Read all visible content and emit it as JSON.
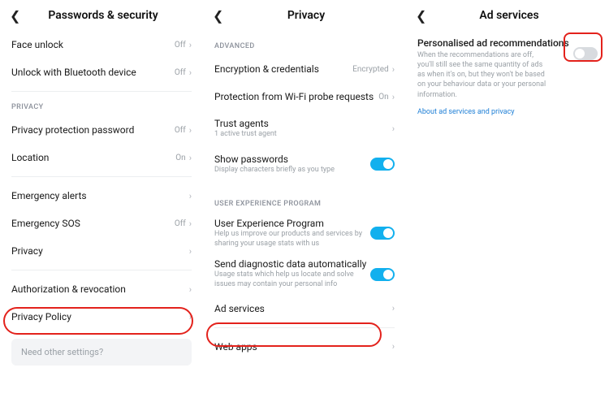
{
  "pane1": {
    "title": "Passwords & security",
    "items": {
      "face_unlock": {
        "label": "Face unlock",
        "value": "Off"
      },
      "bt_unlock": {
        "label": "Unlock with Bluetooth device",
        "value": "Off"
      },
      "section_privacy": "PRIVACY",
      "privacy_pwd": {
        "label": "Privacy protection password",
        "value": "Off"
      },
      "location": {
        "label": "Location",
        "value": "On"
      },
      "emerg_alerts": {
        "label": "Emergency alerts"
      },
      "emerg_sos": {
        "label": "Emergency SOS",
        "value": "Off"
      },
      "privacy": {
        "label": "Privacy"
      },
      "auth_rev": {
        "label": "Authorization & revocation"
      },
      "privacy_pol": {
        "label": "Privacy Policy"
      },
      "footer": "Need other settings?"
    }
  },
  "pane2": {
    "title": "Privacy",
    "sections": {
      "advanced": "ADVANCED",
      "uep": "USER EXPERIENCE PROGRAM"
    },
    "items": {
      "enc": {
        "label": "Encryption & credentials",
        "value": "Encrypted"
      },
      "wifi_probe": {
        "label": "Protection from Wi-Fi probe requests",
        "value": "On"
      },
      "trust": {
        "label": "Trust agents",
        "sub": "1 active trust agent"
      },
      "show_pwd": {
        "label": "Show passwords",
        "sub": "Display characters briefly as you type",
        "on": true
      },
      "uep": {
        "label": "User Experience Program",
        "sub": "Help us improve our products and services by sharing your usage stats with us",
        "on": true
      },
      "diag": {
        "label": "Send diagnostic data automatically",
        "sub": "Usage stats which help us locate and solve issues may contain your personal info",
        "on": true
      },
      "ad": {
        "label": "Ad services"
      },
      "web": {
        "label": "Web apps"
      }
    }
  },
  "pane3": {
    "title": "Ad services",
    "rec": {
      "label": "Personalised ad recommendations",
      "desc": "When the recommendations are off, you'll still see the same quantity of ads as when it's on, but they won't be based on your behaviour data or your personal information.",
      "on": false
    },
    "link": "About ad services and privacy"
  }
}
